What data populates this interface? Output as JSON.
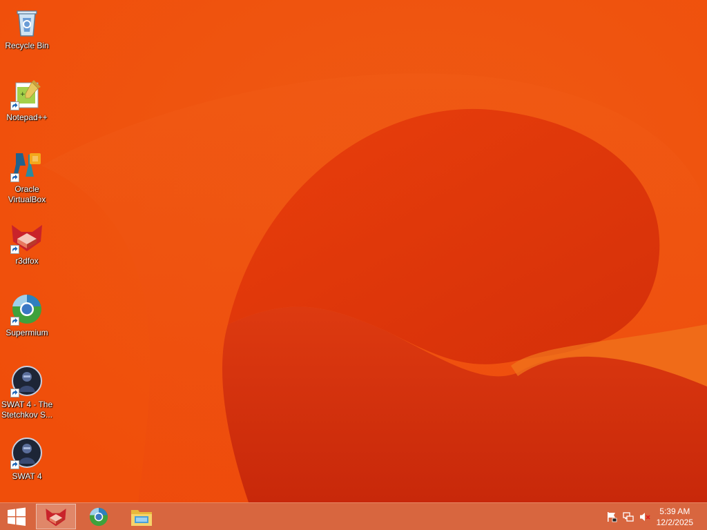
{
  "desktop": {
    "icons": [
      {
        "label": "Recycle Bin",
        "icon": "recycle-bin-icon"
      },
      {
        "label": "Notepad++",
        "icon": "notepad-plus-plus-icon"
      },
      {
        "label": "Oracle VirtualBox",
        "icon": "virtualbox-icon"
      },
      {
        "label": "r3dfox",
        "icon": "r3dfox-icon"
      },
      {
        "label": "Supermium",
        "icon": "supermium-icon"
      },
      {
        "label": "SWAT 4 - The Stetchkov S...",
        "icon": "swat4-stetchkov-icon"
      },
      {
        "label": "SWAT 4",
        "icon": "swat4-icon"
      }
    ]
  },
  "taskbar": {
    "start": "windows-logo-icon",
    "pinned": [
      "r3dfox-icon",
      "supermium-icon",
      "file-explorer-icon"
    ],
    "tray_icons": [
      "action-center-flag-icon",
      "network-icon",
      "volume-muted-icon"
    ],
    "clock": {
      "time": "5:39 AM",
      "date": "12/2/2025"
    }
  },
  "colors": {
    "wallpaper_base": "#ee4a0a",
    "wallpaper_dark": "#c42a0a",
    "taskbar": "#d8663f"
  }
}
